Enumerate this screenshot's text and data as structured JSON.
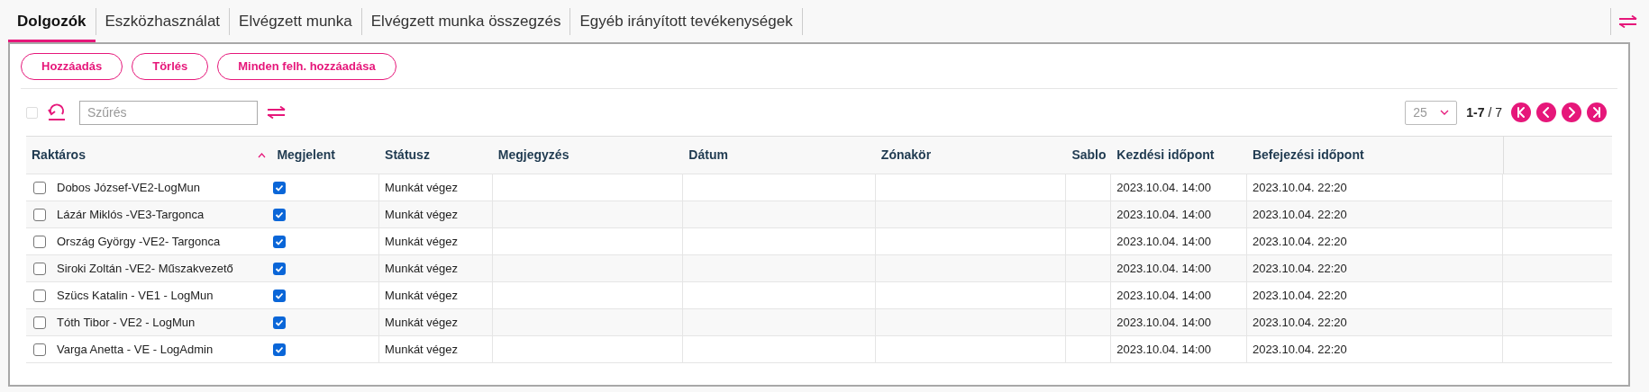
{
  "tabs": [
    {
      "label": "Dolgozók",
      "selected": true
    },
    {
      "label": "Eszközhasználat",
      "selected": false
    },
    {
      "label": "Elvégzett munka",
      "selected": false
    },
    {
      "label": "Elvégzett munka összegzés",
      "selected": false
    },
    {
      "label": "Egyéb irányított tevékenységek",
      "selected": false
    }
  ],
  "actions": [
    "Hozzáadás",
    "Törlés",
    "Minden felh. hozzáadása"
  ],
  "toolbar": {
    "select_all_checked": false,
    "filter_placeholder": "Szűrés",
    "page_size": "25",
    "range": "1-7",
    "separator": "/",
    "total": "7"
  },
  "table": {
    "columns": [
      {
        "label": "Raktáros",
        "sorted": true
      },
      {
        "label": "Megjelent"
      },
      {
        "label": "Státusz"
      },
      {
        "label": "Megjegyzés"
      },
      {
        "label": "Dátum"
      },
      {
        "label": "Zónakör"
      },
      {
        "label": "Sablo"
      },
      {
        "label": "Kezdési időpont"
      },
      {
        "label": "Befejezési időpont"
      }
    ],
    "rows": [
      {
        "selected": false,
        "name": "Dobos József-VE2-LogMun",
        "present": true,
        "status": "Munkát végez",
        "start": "2023.10.04. 14:00",
        "end": "2023.10.04. 22:20"
      },
      {
        "selected": false,
        "name": "Lázár Miklós -VE3-Targonca",
        "present": true,
        "status": "Munkát végez",
        "start": "2023.10.04. 14:00",
        "end": "2023.10.04. 22:20"
      },
      {
        "selected": false,
        "name": "Ország György -VE2- Targonca",
        "present": true,
        "status": "Munkát végez",
        "start": "2023.10.04. 14:00",
        "end": "2023.10.04. 22:20"
      },
      {
        "selected": false,
        "name": "Siroki Zoltán -VE2- Műszakvezető",
        "present": true,
        "status": "Munkát végez",
        "start": "2023.10.04. 14:00",
        "end": "2023.10.04. 22:20"
      },
      {
        "selected": false,
        "name": "Szücs Katalin - VE1 - LogMun",
        "present": true,
        "status": "Munkát végez",
        "start": "2023.10.04. 14:00",
        "end": "2023.10.04. 22:20"
      },
      {
        "selected": false,
        "name": "Tóth Tibor - VE2 - LogMun",
        "present": true,
        "status": "Munkát végez",
        "start": "2023.10.04. 14:00",
        "end": "2023.10.04. 22:20"
      },
      {
        "selected": false,
        "name": "Varga Anetta - VE - LogAdmin",
        "present": true,
        "status": "Munkát végez",
        "start": "2023.10.04. 14:00",
        "end": "2023.10.04. 22:20"
      }
    ]
  }
}
